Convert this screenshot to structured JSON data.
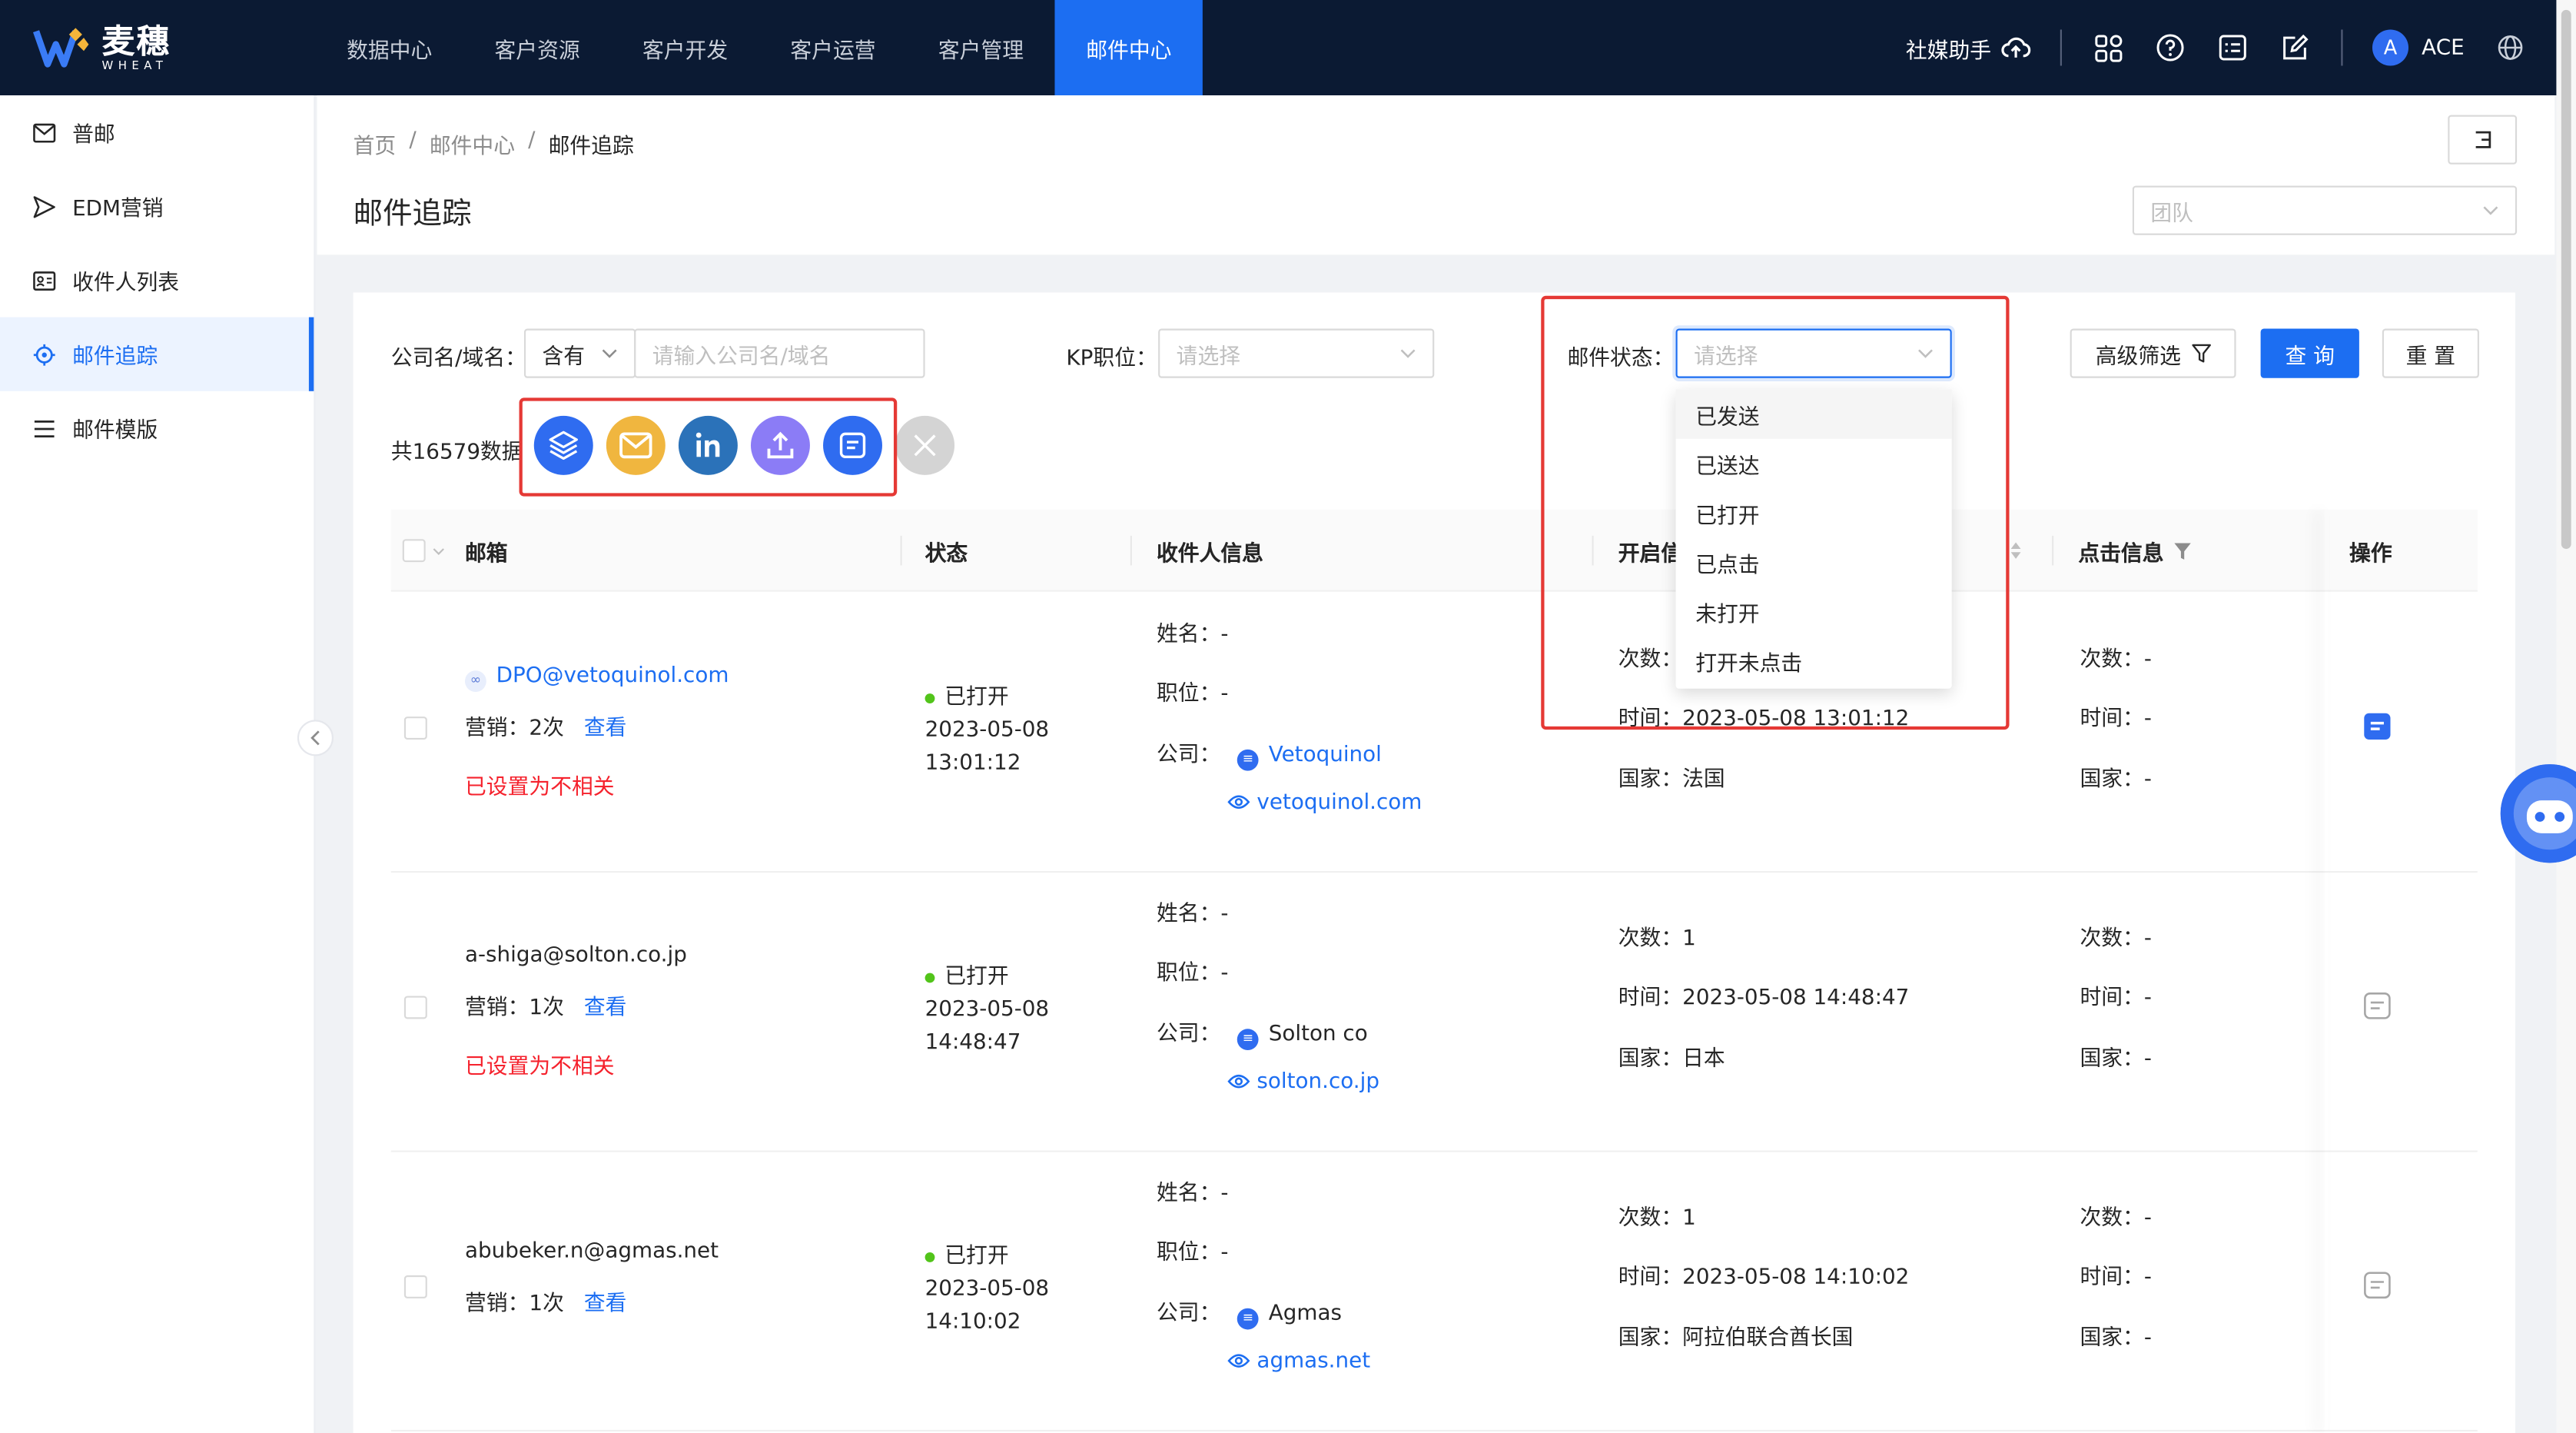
{
  "brand": {
    "name_cn": "麦穗",
    "name_en": "WHEAT"
  },
  "nav": [
    {
      "label": "数据中心"
    },
    {
      "label": "客户资源"
    },
    {
      "label": "客户开发"
    },
    {
      "label": "客户运营"
    },
    {
      "label": "客户管理"
    },
    {
      "label": "邮件中心",
      "active": true
    }
  ],
  "topbar": {
    "assistant_label": "社媒助手",
    "avatar_letter": "A",
    "username": "ACE"
  },
  "sidebar": {
    "items": [
      {
        "label": "普邮",
        "icon": "mail-icon"
      },
      {
        "label": "EDM营销",
        "icon": "send-icon"
      },
      {
        "label": "收件人列表",
        "icon": "contact-card-icon"
      },
      {
        "label": "邮件追踪",
        "icon": "target-icon",
        "active": true
      },
      {
        "label": "邮件模版",
        "icon": "list-icon"
      }
    ]
  },
  "breadcrumb": {
    "home": "首页",
    "sep": "/",
    "section": "邮件中心",
    "current": "邮件追踪"
  },
  "page_title": "邮件追踪",
  "team_select": {
    "placeholder": "团队"
  },
  "filters": {
    "company_label": "公司名/域名：",
    "match_mode": "含有",
    "company_placeholder": "请输入公司名/域名",
    "kp_label": "KP职位：",
    "kp_placeholder": "请选择",
    "status_label": "邮件状态：",
    "status_placeholder": "请选择",
    "advanced_label": "高级筛选",
    "search_label": "查 询",
    "reset_label": "重 置"
  },
  "status_options": [
    "已发送",
    "已送达",
    "已打开",
    "已点击",
    "未打开",
    "打开未点击"
  ],
  "count_text": "共16579数据",
  "columns": {
    "email": "邮箱",
    "status": "状态",
    "recipient": "收件人信息",
    "open": "开启信",
    "click": "点击信息",
    "action": "操作"
  },
  "labels": {
    "name": "姓名：",
    "position": "职位：",
    "company": "公司：",
    "times": "次数：",
    "time": "时间：",
    "country": "国家：",
    "marketing": "营销：",
    "view": "查看"
  },
  "rows": [
    {
      "email": "DPO@vetoquinol.com",
      "email_linked": true,
      "marketing": "2次",
      "flag": "已设置为不相关",
      "status": "已打开",
      "date": "2023-05-08",
      "time": "13:01:12",
      "name": "-",
      "position": "-",
      "company": "Vetoquinol",
      "company_linked": true,
      "domain": "vetoquinol.com",
      "open_times": "",
      "open_time": "2023-05-08 13:01:12",
      "open_country": "法国",
      "click_times": "-",
      "click_time": "-",
      "click_country": "-"
    },
    {
      "email": "a-shiga@solton.co.jp",
      "email_linked": false,
      "marketing": "1次",
      "flag": "已设置为不相关",
      "status": "已打开",
      "date": "2023-05-08",
      "time": "14:48:47",
      "name": "-",
      "position": "-",
      "company": "Solton co",
      "company_linked": false,
      "domain": "solton.co.jp",
      "open_times": "1",
      "open_time": "2023-05-08 14:48:47",
      "open_country": "日本",
      "click_times": "-",
      "click_time": "-",
      "click_country": "-"
    },
    {
      "email": "abubeker.n@agmas.net",
      "email_linked": false,
      "marketing": "1次",
      "flag": "",
      "status": "已打开",
      "date": "2023-05-08",
      "time": "14:10:02",
      "name": "-",
      "position": "-",
      "company": "Agmas",
      "company_linked": false,
      "domain": "agmas.net",
      "open_times": "1",
      "open_time": "2023-05-08 14:10:02",
      "open_country": "阿拉伯联合酋长国",
      "click_times": "-",
      "click_time": "-",
      "click_country": "-"
    }
  ],
  "colors": {
    "accent": "#1c6ef2",
    "header_bg": "#0b1a33",
    "flag_red": "#f5222d",
    "highlight": "#e53935",
    "open_dot": "#52c41a"
  }
}
